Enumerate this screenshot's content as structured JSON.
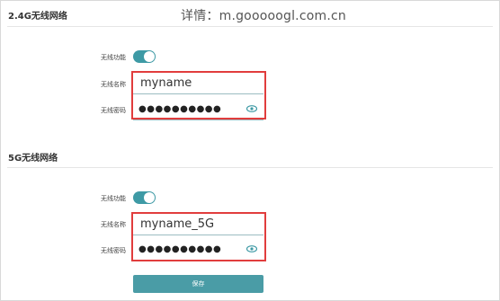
{
  "watermark": "详情：m.gooooogl.com.cn",
  "sections": [
    {
      "title": "2.4G无线网络",
      "wireless_label": "无线功能",
      "wireless_on": true,
      "name_label": "无线名称",
      "name_value": "myname",
      "password_label": "无线密码",
      "password_value": "●●●●●●●●●●"
    },
    {
      "title": "5G无线网络",
      "wireless_label": "无线功能",
      "wireless_on": true,
      "name_label": "无线名称",
      "name_value": "myname_5G",
      "password_label": "无线密码",
      "password_value": "●●●●●●●●●●"
    }
  ],
  "save_label": "保存",
  "colors": {
    "accent": "#3e9aa5",
    "highlight": "#e13d3d"
  },
  "icons": {
    "show_password": "eye-icon"
  }
}
